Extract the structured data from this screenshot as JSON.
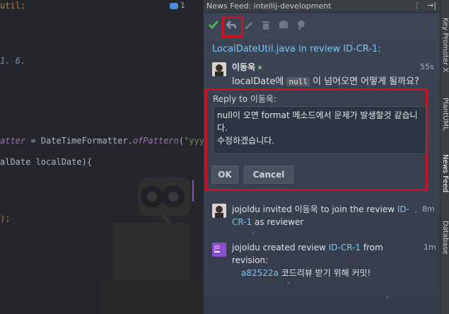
{
  "editor": {
    "lines": [
      {
        "t1": "util;",
        "t2": ""
      },
      {
        "t1": "1. 6.",
        "t2": ""
      },
      {
        "t1": "atter",
        "t2": " = DateTimeFormatter.",
        "t3": "ofPattern",
        "t4": "(",
        "t5": "\"yyyy"
      },
      {
        "t1": "alDate localDate){",
        "t2": ""
      },
      {
        "t1": ");",
        "t2": ""
      }
    ],
    "comment_count": "1"
  },
  "panel": {
    "title": "News Feed: intellij-development",
    "review_title": "LocalDateUtil.java in review ID-CR-1:",
    "comment": {
      "author": "이동욱",
      "time": "55s",
      "msg_before": "localDate에 ",
      "code": "null",
      "msg_after": " 이 넘어오면 어떻게 될까요?"
    },
    "reply": {
      "label": "Reply to 이동욱:",
      "text": "null이 오면 format 메소드에서 문제가 발생할것 같습니다.\n수정하겠습니다.",
      "ok_label": "OK",
      "cancel_label": "Cancel"
    },
    "feed": [
      {
        "user": "jojoldu",
        "action": " invited 이동욱 to join the review ",
        "link": "ID-CR-1",
        "rest": " as reviewer",
        "time": "8m"
      },
      {
        "user": "jojoldu",
        "action": " created review ",
        "link": "ID-CR-1",
        "rest": " from revision:",
        "time": "1m",
        "commit_hash": "a82522a",
        "commit_msg": " 코드리뷰 받기 위해 커밋!"
      }
    ]
  },
  "sidebar": {
    "labels": [
      "Key Promoter X",
      "PlantUML",
      "News Feed",
      "Database"
    ]
  },
  "colors": {
    "accent": "#7cc6f2",
    "highlight": "#d0101e",
    "check": "#4fb34f"
  }
}
